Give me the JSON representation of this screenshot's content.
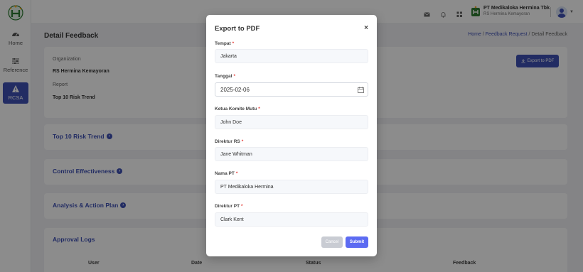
{
  "sidebar": {
    "items": [
      {
        "label": "Home",
        "icon": "dashboard-icon"
      },
      {
        "label": "Reference",
        "icon": "sliders-icon"
      },
      {
        "label": "RCSA",
        "icon": "warning-icon"
      }
    ]
  },
  "topbar": {
    "org_name": "PT Medikaloka Hermina Tbk",
    "org_sub": "RS Hermina Kemayoran"
  },
  "header": {
    "title": "Detail Feedback",
    "breadcrumb": [
      "Home",
      "/",
      "Feedback Request",
      "/",
      "Detail Feedback"
    ]
  },
  "info": {
    "org_label": "Organization",
    "org_value": "RS Hermina Kemayoran",
    "report_label": "Report",
    "report_value": "Top 10 Risk Trend",
    "export_label": "Export to PDF"
  },
  "sections": [
    "Top 10 Risk Trend",
    "Control Effectiveness",
    "Analysis & Action Plan"
  ],
  "approval": {
    "title": "Approval Logs",
    "columns": [
      "User",
      "Date",
      "Status",
      "Feedback"
    ]
  },
  "modal": {
    "title": "Export to PDF",
    "close": "×",
    "fields": [
      {
        "label": "Tempat",
        "value": "Jakarta"
      },
      {
        "label": "Tanggal",
        "value": "2025-02-06"
      },
      {
        "label": "Ketua Komite Mutu",
        "value": "John Doe"
      },
      {
        "label": "Direktur RS",
        "value": "Jane Whitman"
      },
      {
        "label": "Nama PT",
        "value": "PT Medikaloka Hermina"
      },
      {
        "label": "Direktur PT",
        "value": "Clark Kent"
      }
    ],
    "required_mark": "*",
    "cancel_label": "Cancel",
    "submit_label": "Submit"
  },
  "colors": {
    "primary": "#3f51b5",
    "submit": "#5c6bf2",
    "required": "#e53935"
  }
}
